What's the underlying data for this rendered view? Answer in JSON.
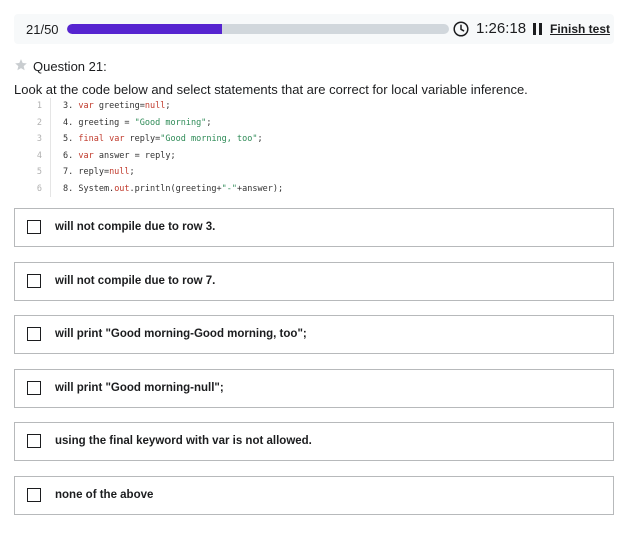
{
  "header": {
    "question_count": "21/50",
    "progress": 0.405,
    "timer": "1:26:18",
    "finish_label": "Finish test",
    "accent_color": "#5624d0"
  },
  "question": {
    "number_label": "Question 21:",
    "prompt": "Look at the code below and select statements that are correct for local variable inference.",
    "code_lines": [
      {
        "ln": "1",
        "parts": [
          {
            "t": "3. "
          },
          {
            "t": "var",
            "c": "kw"
          },
          {
            "t": " greeting="
          },
          {
            "t": "null",
            "c": "kw"
          },
          {
            "t": ";"
          }
        ]
      },
      {
        "ln": "2",
        "parts": [
          {
            "t": "4. greeting = "
          },
          {
            "t": "\"Good morning\"",
            "c": "str"
          },
          {
            "t": ";"
          }
        ]
      },
      {
        "ln": "3",
        "parts": [
          {
            "t": "5. "
          },
          {
            "t": "final",
            "c": "kw"
          },
          {
            "t": " "
          },
          {
            "t": "var",
            "c": "kw"
          },
          {
            "t": " reply="
          },
          {
            "t": "\"Good morning, too\"",
            "c": "str"
          },
          {
            "t": ";"
          }
        ]
      },
      {
        "ln": "4",
        "parts": [
          {
            "t": "6. "
          },
          {
            "t": "var",
            "c": "kw"
          },
          {
            "t": " answer = reply;"
          }
        ]
      },
      {
        "ln": "5",
        "parts": [
          {
            "t": "7. reply="
          },
          {
            "t": "null",
            "c": "kw"
          },
          {
            "t": ";"
          }
        ]
      },
      {
        "ln": "6",
        "parts": [
          {
            "t": "8. System."
          },
          {
            "t": "out",
            "c": "kw"
          },
          {
            "t": ".println(greeting+"
          },
          {
            "t": "\"-\"",
            "c": "str"
          },
          {
            "t": "+answer);"
          }
        ]
      }
    ]
  },
  "options": [
    {
      "label": "will not compile due to row 3."
    },
    {
      "label": "will not compile due to row 7."
    },
    {
      "label": "will print \"Good morning-Good morning, too\";"
    },
    {
      "label": "will print \"Good morning-null\";"
    },
    {
      "label": "using the final keyword with var is not allowed."
    },
    {
      "label": "none of the above"
    }
  ]
}
